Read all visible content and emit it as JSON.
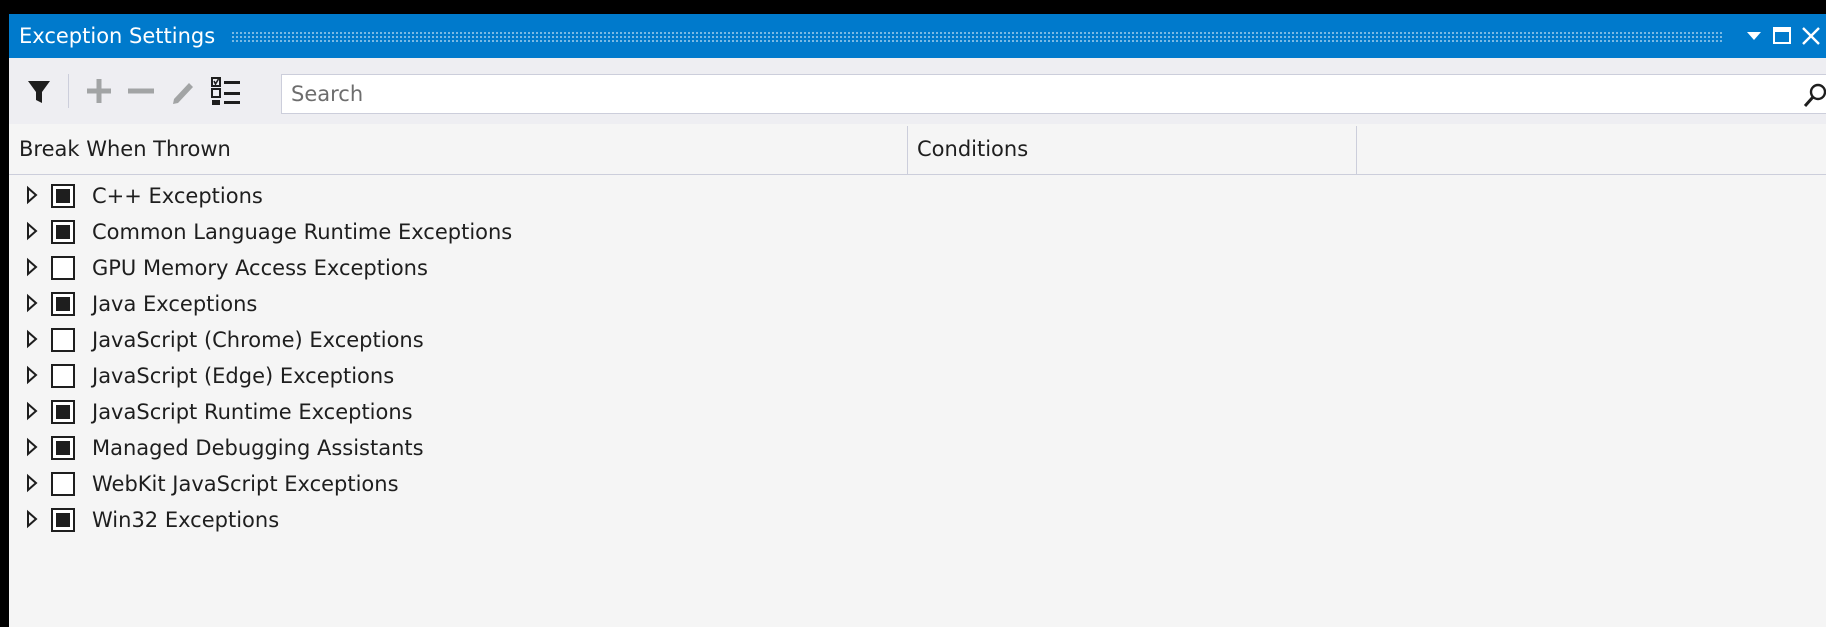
{
  "window": {
    "title": "Exception Settings"
  },
  "toolbar": {
    "filter_icon": "filter-icon",
    "add_icon": "plus-icon",
    "remove_icon": "minus-icon",
    "edit_icon": "pencil-icon",
    "restore_icon": "restore-defaults-icon"
  },
  "search": {
    "placeholder": "Search",
    "value": ""
  },
  "columns": {
    "break_when_thrown": "Break When Thrown",
    "conditions": "Conditions"
  },
  "exceptions": [
    {
      "label": "C++ Exceptions",
      "checked": true
    },
    {
      "label": "Common Language Runtime Exceptions",
      "checked": true
    },
    {
      "label": "GPU Memory Access Exceptions",
      "checked": false
    },
    {
      "label": "Java Exceptions",
      "checked": true
    },
    {
      "label": "JavaScript (Chrome) Exceptions",
      "checked": false
    },
    {
      "label": "JavaScript (Edge) Exceptions",
      "checked": false
    },
    {
      "label": "JavaScript Runtime Exceptions",
      "checked": true
    },
    {
      "label": "Managed Debugging Assistants",
      "checked": true
    },
    {
      "label": "WebKit JavaScript Exceptions",
      "checked": false
    },
    {
      "label": "Win32 Exceptions",
      "checked": true
    }
  ],
  "colors": {
    "titlebar": "#007acc",
    "background": "#f5f5f5",
    "toolbar": "#eeeef2",
    "text": "#1e1e1e",
    "disabled_icon": "#a2a4a5"
  }
}
